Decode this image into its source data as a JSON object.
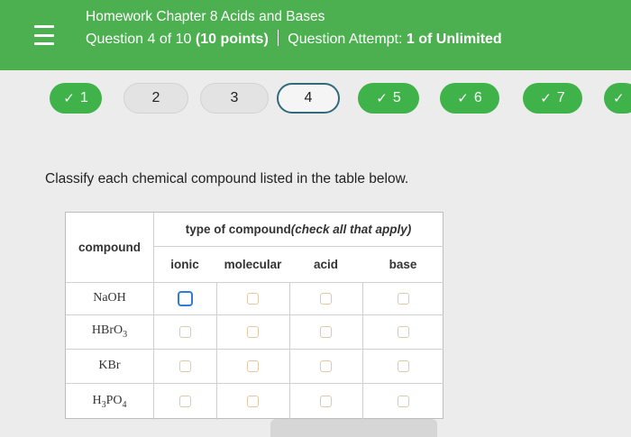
{
  "header": {
    "title": "Homework Chapter 8 Acids and Bases",
    "question_prefix": "Question 4 of 10",
    "points": "(10 points)",
    "attempt_label": "Question Attempt:",
    "attempt_value": "1 of Unlimited"
  },
  "nav": {
    "questions": [
      {
        "label": "1",
        "status": "done"
      },
      {
        "label": "2",
        "status": "unanswered"
      },
      {
        "label": "3",
        "status": "unanswered"
      },
      {
        "label": "4",
        "status": "current"
      },
      {
        "label": "5",
        "status": "done"
      },
      {
        "label": "6",
        "status": "done"
      },
      {
        "label": "7",
        "status": "done"
      }
    ],
    "check_glyph": "✓"
  },
  "prompt": "Classify each chemical compound listed in the table below.",
  "table": {
    "compound_header": "compound",
    "type_header": "type of compound (check all that apply)",
    "columns": [
      "ionic",
      "molecular",
      "acid",
      "base"
    ],
    "rows": [
      {
        "formula": "NaOH",
        "checked": [
          false,
          false,
          false,
          false
        ]
      },
      {
        "formula": "HBrO3",
        "checked": [
          false,
          false,
          false,
          false
        ]
      },
      {
        "formula": "KBr",
        "checked": [
          false,
          false,
          false,
          false
        ]
      },
      {
        "formula": "H3PO4",
        "checked": [
          false,
          false,
          false,
          false
        ]
      }
    ]
  },
  "colors": {
    "header_bg": "#4caf50",
    "done_pill": "#3fb24a",
    "focus_border": "#2f7bd6"
  }
}
